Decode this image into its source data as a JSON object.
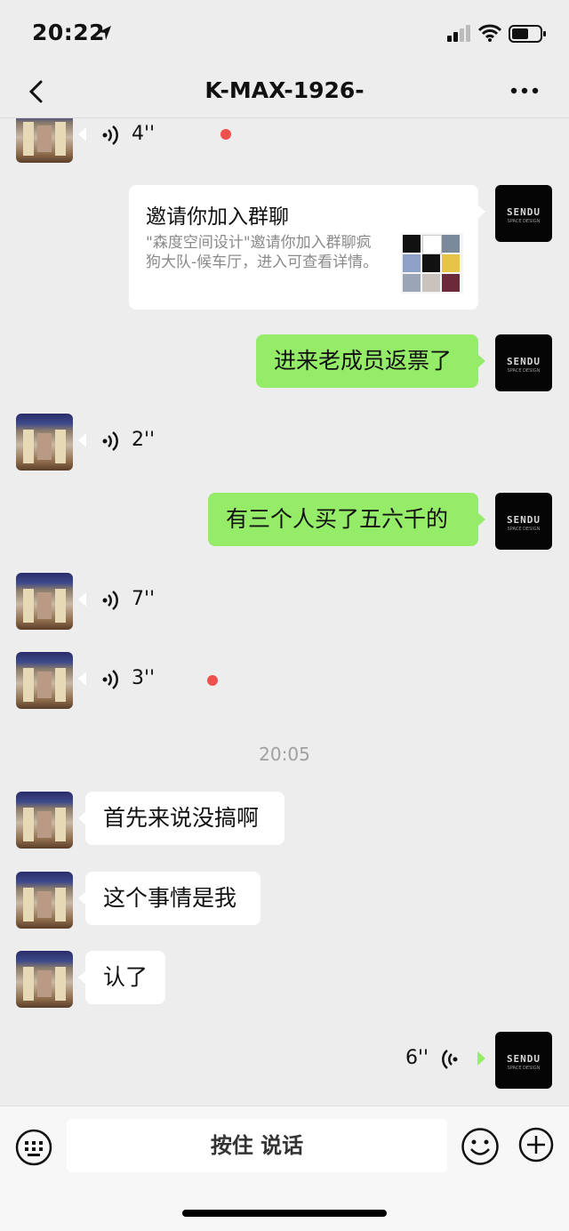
{
  "status_bar": {
    "time": "20:22"
  },
  "header": {
    "title": "K-MAX-1926-"
  },
  "avatar_brand": {
    "name": "SENDU",
    "subtitle": "SPACE DESIGN"
  },
  "messages": {
    "voice_4": "4''",
    "invite": {
      "title": "邀请你加入群聊",
      "description": "\"森度空间设计\"邀请你加入群聊疯狗大队-候车厅，进入可查看详情。"
    },
    "text_1": "进来老成员返票了",
    "voice_2": "2''",
    "text_2": "有三个人买了五六千的",
    "voice_7": "7''",
    "voice_3": "3''",
    "timestamp": "20:05",
    "text_3": "首先来说没搞啊",
    "text_4": "这个事情是我",
    "text_5": "认了",
    "voice_6": "6''"
  },
  "input_bar": {
    "hold_to_talk": "按住 说话"
  },
  "colors": {
    "green_bubble": "#95ec69",
    "unread_dot": "#f0514e",
    "background": "#ededed"
  }
}
